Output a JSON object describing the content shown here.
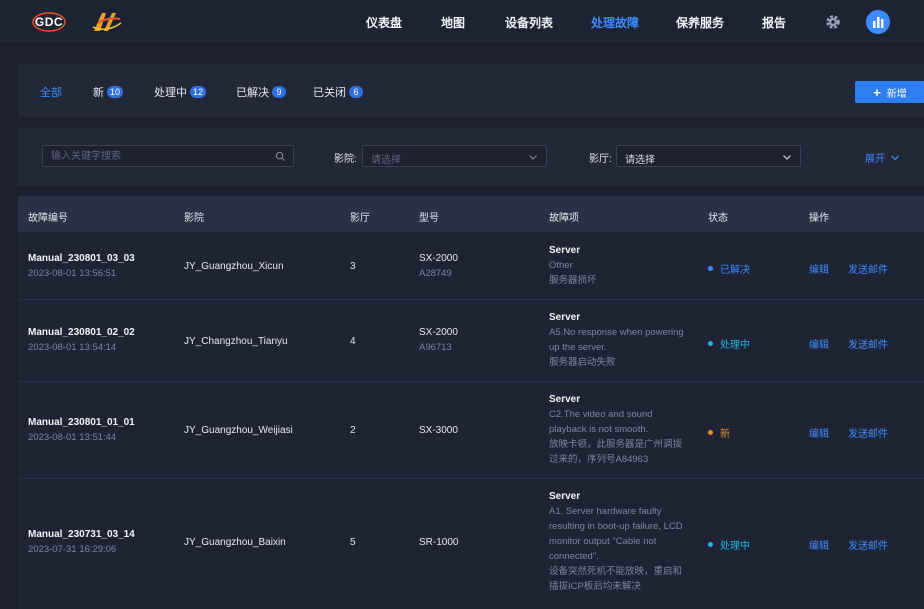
{
  "header": {
    "logo_text": "GDC",
    "nav": [
      {
        "label": "仪表盘",
        "active": false
      },
      {
        "label": "地图",
        "active": false
      },
      {
        "label": "设备列表",
        "active": false
      },
      {
        "label": "处理故障",
        "active": true
      },
      {
        "label": "保养服务",
        "active": false
      },
      {
        "label": "报告",
        "active": false
      }
    ],
    "icons": [
      "gear-icon",
      "avatar-chart-icon"
    ]
  },
  "status_tabs": [
    {
      "label": "全部",
      "count": null,
      "active": true
    },
    {
      "label": "新",
      "count": "10",
      "active": false
    },
    {
      "label": "处理中",
      "count": "12",
      "active": false
    },
    {
      "label": "已解决",
      "count": "9",
      "active": false
    },
    {
      "label": "已关闭",
      "count": "6",
      "active": false
    }
  ],
  "add_button": {
    "label": "新增",
    "icon": "plus-icon"
  },
  "filters": {
    "search_placeholder": "输入关键字搜索",
    "cinema_label": "影院:",
    "cinema_placeholder": "请选择",
    "hall_label": "影厅:",
    "hall_value": "请选择",
    "expand_label": "展开"
  },
  "table": {
    "columns": [
      "故障编号",
      "影院",
      "影厅",
      "型号",
      "故障项",
      "状态",
      "操作"
    ],
    "rows": [
      {
        "id": "Manual_230801_03_03",
        "time": "2023-08-01 13:56:51",
        "cinema": "JY_Guangzhou_Xicun",
        "hall": "3",
        "model": "SX-2000",
        "serial": "A28749",
        "fault_title": "Server",
        "fault_lines": [
          "Other",
          "服务器损坏"
        ],
        "status": "已解决",
        "status_color": "#3d8bff",
        "actions": [
          "编辑",
          "发送邮件"
        ]
      },
      {
        "id": "Manual_230801_02_02",
        "time": "2023-08-01 13:54:14",
        "cinema": "JY_Changzhou_Tianyu",
        "hall": "4",
        "model": "SX-2000",
        "serial": "A96713",
        "fault_title": "Server",
        "fault_lines": [
          "A5.No response when powering",
          "up the server.",
          "服务器启动失败"
        ],
        "status": "处理中",
        "status_color": "#1fb4e6",
        "actions": [
          "编辑",
          "发送邮件"
        ]
      },
      {
        "id": "Manual_230801_01_01",
        "time": "2023-08-01 13:51:44",
        "cinema": "JY_Guangzhou_Weijiasi",
        "hall": "2",
        "model": "SX-3000",
        "serial": "",
        "fault_title": "Server",
        "fault_lines": [
          "C2.The video and sound",
          "playback is not smooth.",
          "放映卡顿，此服务器是广州调拨",
          "过来的，序列号A84963"
        ],
        "status": "新",
        "status_color": "#e08a2e",
        "actions": [
          "编辑",
          "发送邮件"
        ]
      },
      {
        "id": "Manual_230731_03_14",
        "time": "2023-07-31 16:29:06",
        "cinema": "JY_Guangzhou_Baixin",
        "hall": "5",
        "model": "SR-1000",
        "serial": "",
        "fault_title": "Server",
        "fault_lines": [
          "A1. Server hardware faulty",
          "resulting in boot-up failure, LCD",
          "monitor output \"Cable not",
          "connected\".",
          "设备突然死机不能放映，重启和",
          "插拔ICP板后均未解决"
        ],
        "status": "处理中",
        "status_color": "#1fb4e6",
        "actions": [
          "编辑",
          "发送邮件"
        ]
      }
    ]
  }
}
